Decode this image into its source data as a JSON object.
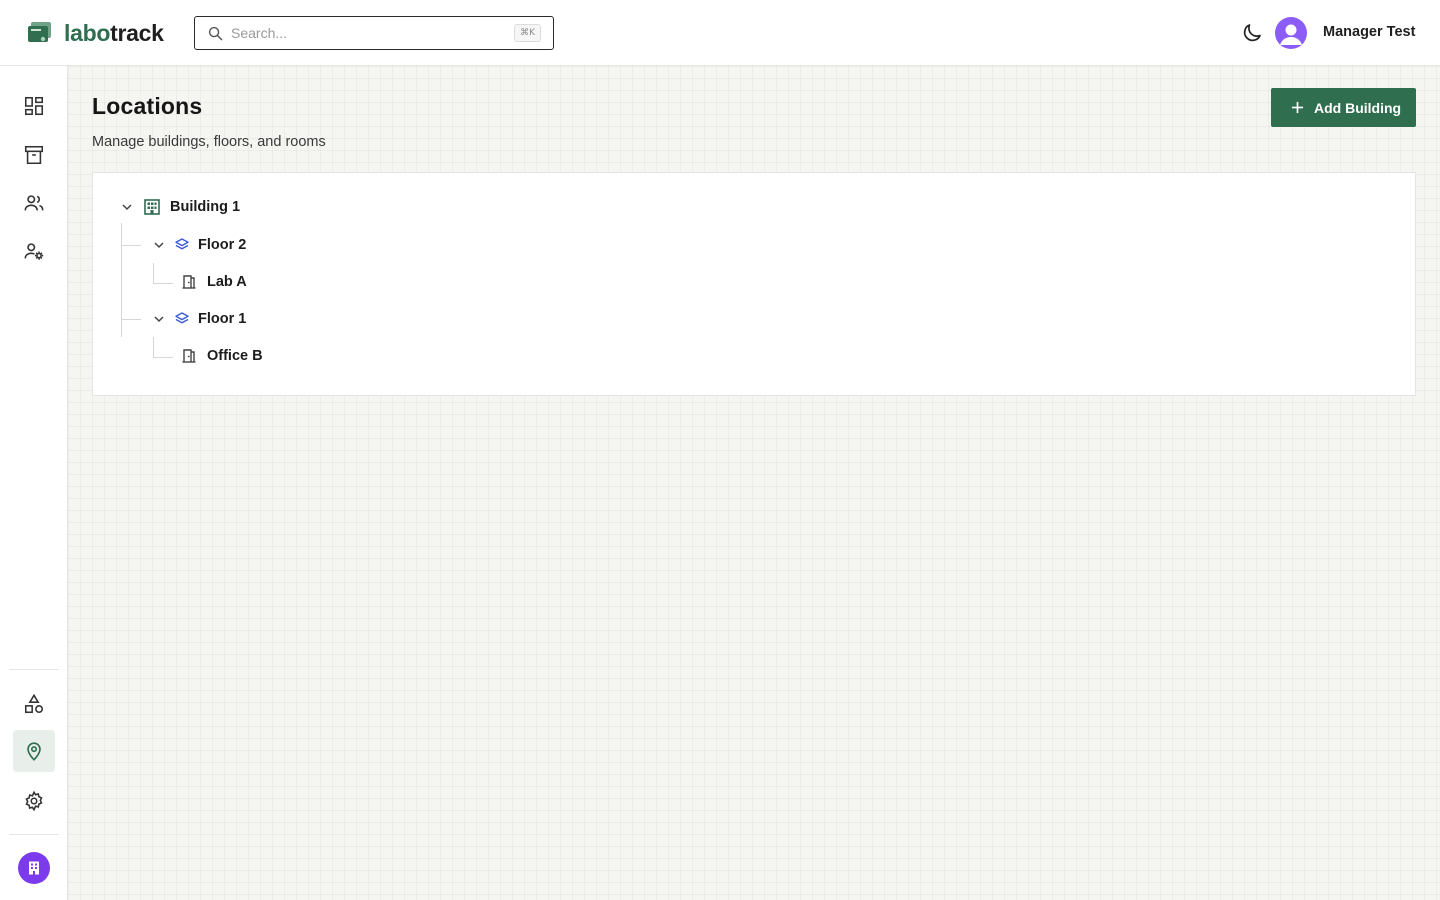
{
  "app": {
    "brand_prefix": "labo",
    "brand_suffix": "track",
    "brand_color": "#2f6e4f"
  },
  "search": {
    "placeholder": "Search...",
    "shortcut": "⌘K"
  },
  "header": {
    "theme_icon": "moon-icon",
    "user_name": "Manager Test"
  },
  "sidebar": {
    "top_items": [
      {
        "icon": "dashboard-icon",
        "label": "Dashboard"
      },
      {
        "icon": "archive-icon",
        "label": "Inventory"
      },
      {
        "icon": "users-icon",
        "label": "Users"
      },
      {
        "icon": "user-settings-icon",
        "label": "User management"
      }
    ],
    "bottom_items": [
      {
        "icon": "shapes-icon",
        "label": "Categories"
      },
      {
        "icon": "map-pin-icon",
        "label": "Locations",
        "active": true
      },
      {
        "icon": "gear-icon",
        "label": "Settings"
      }
    ],
    "org_icon": "building-icon",
    "active_color": "#e8efea"
  },
  "page": {
    "title": "Locations",
    "subtitle": "Manage buildings, floors, and rooms",
    "add_button_label": "Add Building"
  },
  "tree": {
    "building": "Building 1",
    "floors": [
      {
        "name": "Floor 2",
        "rooms": [
          "Lab A"
        ]
      },
      {
        "name": "Floor 1",
        "rooms": [
          "Office B"
        ]
      }
    ]
  },
  "colors": {
    "accent": "#2f6e4f",
    "floor_icon": "#3b5bdb",
    "avatar": "#8b5cf6"
  }
}
